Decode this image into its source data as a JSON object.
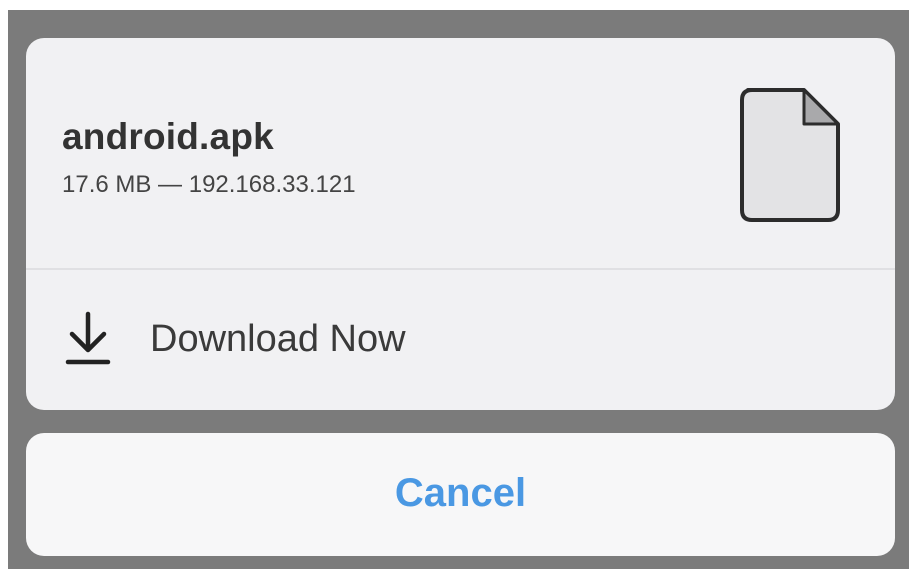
{
  "download_sheet": {
    "file_name": "android.apk",
    "file_meta": "17.6 MB — 192.168.33.121",
    "file_icon": "document-icon",
    "download_label": "Download Now",
    "download_icon": "download-arrow-icon"
  },
  "cancel": {
    "label": "Cancel"
  },
  "colors": {
    "backdrop": "#7b7b7b",
    "sheet_background": "#f1f1f3",
    "cancel_background": "#f7f7f8",
    "accent": "#4a98e3",
    "text_primary": "#333333"
  }
}
